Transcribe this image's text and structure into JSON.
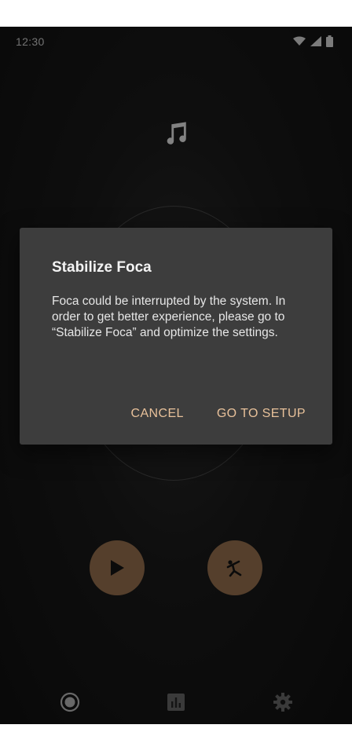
{
  "status_bar": {
    "time": "12:30",
    "icons": [
      "wifi-icon",
      "signal-icon",
      "battery-icon"
    ]
  },
  "main": {
    "music_icon": "music-note-icon",
    "buttons": [
      {
        "icon": "play-icon"
      },
      {
        "icon": "yoga-pose-icon"
      }
    ]
  },
  "bottom_nav": {
    "items": [
      {
        "icon": "record-icon"
      },
      {
        "icon": "bar-chart-icon"
      },
      {
        "icon": "gear-icon"
      }
    ]
  },
  "dialog": {
    "title": "Stabilize Foca",
    "message": "Foca could be interrupted by the system. In order to get better experience, please go to “Stabilize Foca” and optimize the settings.",
    "cancel_label": "CANCEL",
    "confirm_label": "GO TO SETUP"
  },
  "colors": {
    "accent": "#e8c19a",
    "fab": "#9c7450",
    "dialog_bg": "#3d3d3d",
    "background": "#1a1a1a"
  }
}
